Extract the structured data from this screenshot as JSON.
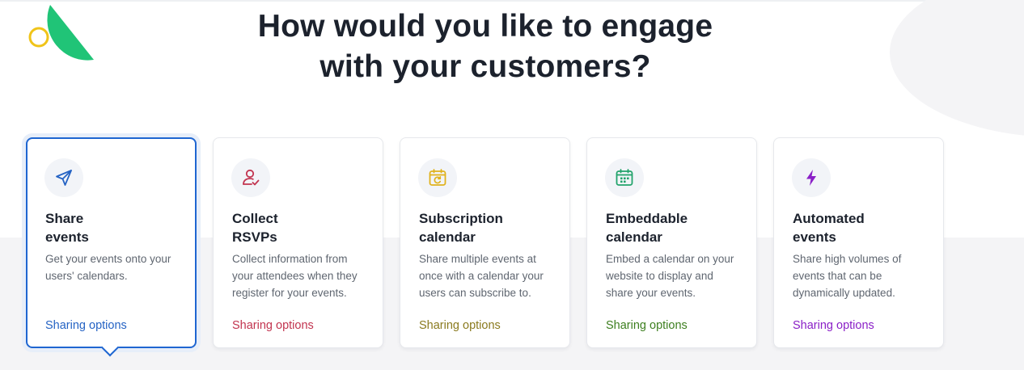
{
  "heading": {
    "line1": "How would you like to engage",
    "line2": "with your customers?"
  },
  "cards": [
    {
      "title_line1": "Share",
      "title_line2": "events",
      "description": "Get your events onto your users' calendars.",
      "link": "Sharing options",
      "icon": "send-icon",
      "accent": "#2563c4",
      "selected": true
    },
    {
      "title_line1": "Collect",
      "title_line2": "RSVPs",
      "description": "Collect information from your attendees when they register for your events.",
      "link": "Sharing options",
      "icon": "user-check-icon",
      "accent": "#c2344f"
    },
    {
      "title_line1": "Subscription",
      "title_line2": "calendar",
      "description": "Share multiple events at once with a calendar your users can subscribe to.",
      "link": "Sharing options",
      "icon": "calendar-refresh-icon",
      "accent": "#8a7a1e",
      "icon_color": "#e0b21c"
    },
    {
      "title_line1": "Embeddable",
      "title_line2": "calendar",
      "description": "Embed a calendar on your website to display and share your events.",
      "link": "Sharing options",
      "icon": "calendar-grid-icon",
      "accent": "#3d7f1f",
      "icon_color": "#22a36b"
    },
    {
      "title_line1": "Automated",
      "title_line2": "events",
      "description": "Share high volumes of events that can be dynamically updated.",
      "link": "Sharing options",
      "icon": "lightning-icon",
      "accent": "#8a1fc7"
    }
  ]
}
